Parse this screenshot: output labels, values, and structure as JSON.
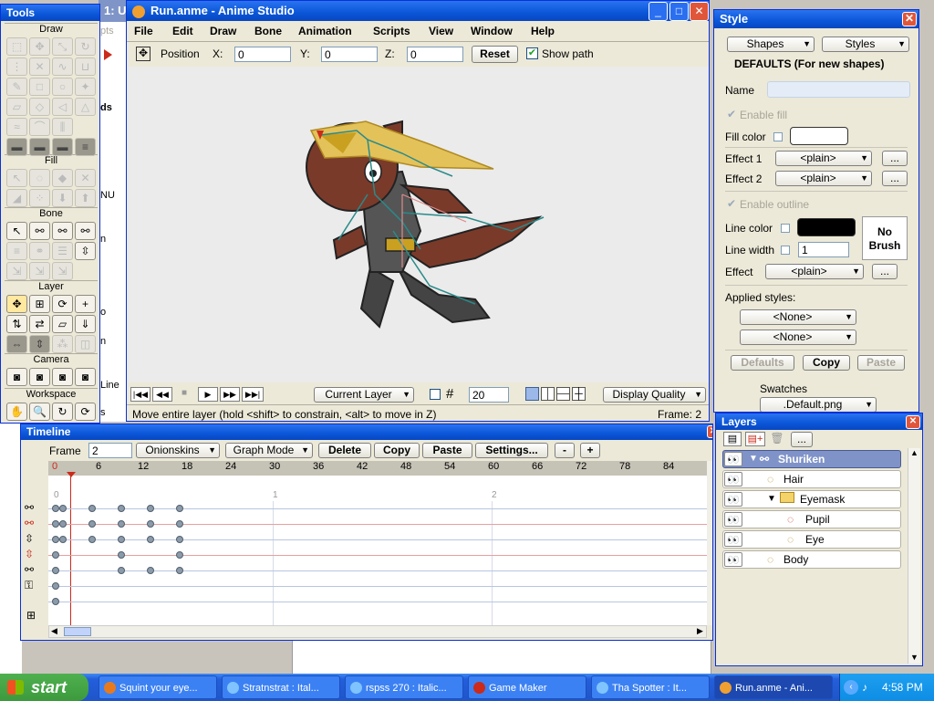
{
  "app": {
    "title": "Run.anme - Anime Studio",
    "menu": [
      "File",
      "Edit",
      "Draw",
      "Bone",
      "Animation",
      "Scripts",
      "View",
      "Window",
      "Help"
    ]
  },
  "colors": {
    "accent": "#0a56d8",
    "taskbar": "#245edb",
    "start": "#3c9a3c",
    "fill_red": "#cc2a1a"
  },
  "toolbar": {
    "position_label": "Position",
    "x_label": "X:",
    "x_value": "0",
    "y_label": "Y:",
    "y_value": "0",
    "z_label": "Z:",
    "z_value": "0",
    "reset_label": "Reset",
    "show_path_label": "Show path"
  },
  "background_window": {
    "title_fragment": "1: U",
    "text_fragments": [
      "pts",
      "ds",
      "NU",
      "n",
      "o",
      "n",
      "Line",
      "s"
    ]
  },
  "tools": {
    "title": "Tools",
    "sections": [
      "Draw",
      "Fill",
      "Bone",
      "Layer",
      "Camera",
      "Workspace"
    ]
  },
  "canvas_footer": {
    "layer_mode": "Current Layer",
    "grid_value": "20",
    "quality": "Display Quality",
    "status": "Move entire layer (hold <shift> to constrain, <alt> to move in Z)",
    "frame_status": "Frame: 2"
  },
  "style": {
    "title": "Style",
    "shapes_label": "Shapes",
    "styles_label": "Styles",
    "defaults_heading": "DEFAULTS (For new shapes)",
    "name_label": "Name",
    "enable_fill_label": "Enable fill",
    "fill_color_label": "Fill color",
    "effect1_label": "Effect 1",
    "effect1_value": "<plain>",
    "effect2_label": "Effect 2",
    "effect2_value": "<plain>",
    "more": "...",
    "enable_outline_label": "Enable outline",
    "line_color_label": "Line color",
    "line_width_label": "Line width",
    "line_width_value": "1",
    "effect_label": "Effect",
    "effect_value": "<plain>",
    "no_brush_label": "No Brush",
    "applied_styles_label": "Applied styles:",
    "applied1": "<None>",
    "applied2": "<None>",
    "defaults_button": "Defaults",
    "copy_button": "Copy",
    "paste_button": "Paste",
    "swatches_label": "Swatches",
    "swatches_value": ".Default.png",
    "fill_swatch": "#ffffff",
    "line_swatch": "#000000"
  },
  "timeline": {
    "title": "Timeline",
    "frame_label": "Frame",
    "frame_value": "2",
    "onionskins": "Onionskins",
    "graph_mode": "Graph Mode",
    "delete_label": "Delete",
    "copy_label": "Copy",
    "paste_label": "Paste",
    "settings_label": "Settings...",
    "minus": "-",
    "plus": "+",
    "ruler": [
      "0",
      "6",
      "12",
      "18",
      "24",
      "30",
      "36",
      "42",
      "48",
      "54",
      "60",
      "66",
      "72",
      "78",
      "84"
    ],
    "seconds": [
      "0",
      "1",
      "2"
    ],
    "keyframe_rows": [
      [
        0,
        1,
        5,
        9,
        13,
        17
      ],
      [
        0,
        1,
        5,
        9,
        13,
        17
      ],
      [
        0,
        1,
        5,
        9,
        13,
        17
      ],
      [
        0,
        9,
        17
      ],
      [
        0,
        9,
        13,
        17
      ],
      [
        0
      ],
      [
        0
      ]
    ]
  },
  "layers": {
    "title": "Layers",
    "more": "...",
    "items": [
      {
        "name": "Shuriken",
        "type": "bone",
        "selected": true
      },
      {
        "name": "Hair",
        "type": "vector"
      },
      {
        "name": "Eyemask",
        "type": "group"
      },
      {
        "name": "Pupil",
        "type": "vector"
      },
      {
        "name": "Eye",
        "type": "vector"
      },
      {
        "name": "Body",
        "type": "vector"
      }
    ]
  },
  "taskbar": {
    "start": "start",
    "items": [
      "Squint your eye...",
      "Stratnstrat : Ital...",
      "rspss 270 : Italic...",
      "Game Maker",
      "Tha Spotter : It...",
      "Run.anme - Ani..."
    ],
    "clock": "4:58 PM"
  }
}
